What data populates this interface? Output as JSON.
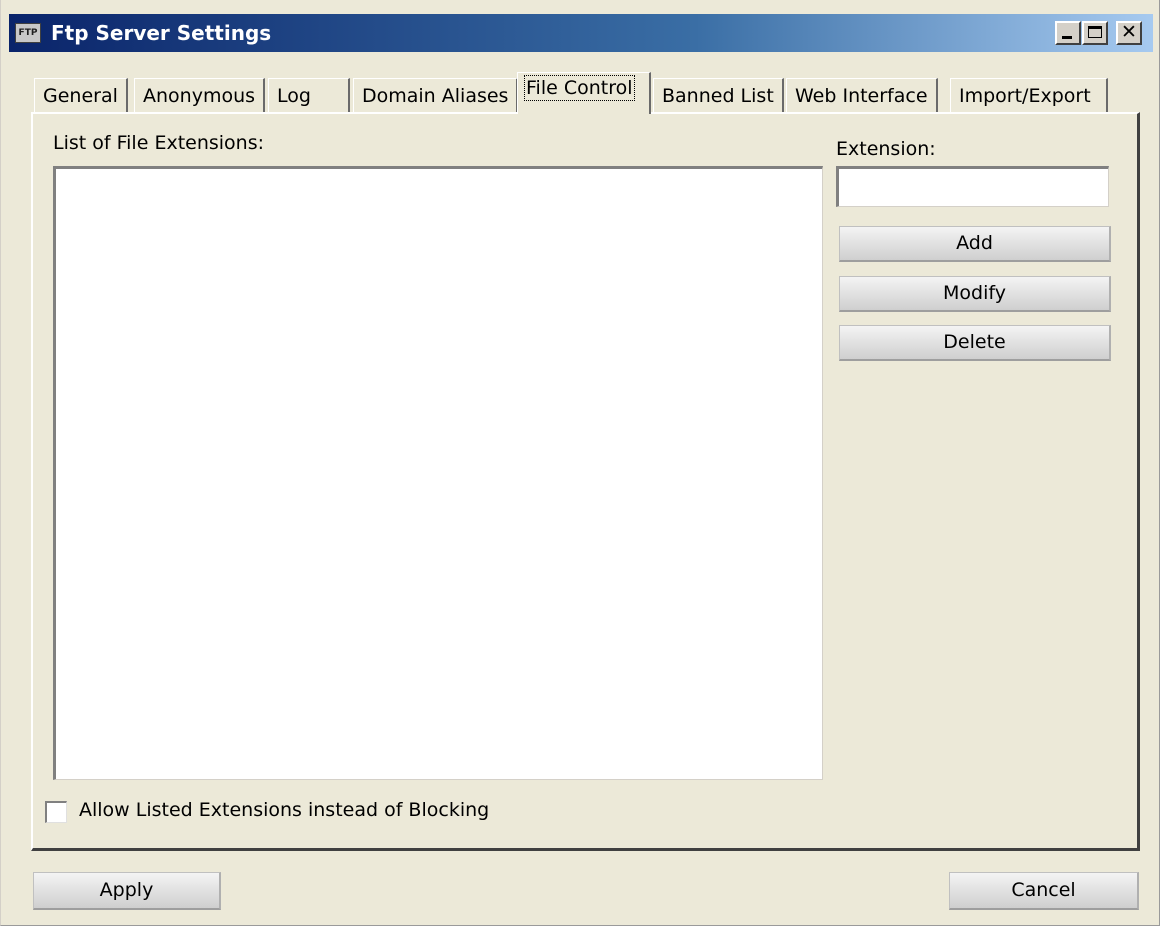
{
  "window": {
    "title": "Ftp Server Settings",
    "icon_text": "FTP",
    "controls": {
      "minimize": "minimize-icon",
      "maximize": "maximize-icon",
      "close_glyph": "✕"
    },
    "colors": {
      "titlebar_start": "#0a246a",
      "titlebar_end": "#a6caf0",
      "face": "#ece9d8"
    }
  },
  "tabs": [
    {
      "label": "General"
    },
    {
      "label": "Anonymous"
    },
    {
      "label": "Log"
    },
    {
      "label": "Domain Aliases"
    },
    {
      "label": "File Control"
    },
    {
      "label": "Banned List"
    },
    {
      "label": "Web Interface"
    },
    {
      "label": "Import/Export"
    }
  ],
  "active_tab": "File Control",
  "file_control": {
    "list_label": "List of File Extensions:",
    "list_items": [],
    "extension_label": "Extension:",
    "extension_value": "",
    "buttons": {
      "add": "Add",
      "modify": "Modify",
      "delete": "Delete"
    },
    "allow_listed": {
      "label": "Allow Listed Extensions instead of Blocking",
      "checked": false
    }
  },
  "footer": {
    "apply": "Apply",
    "cancel": "Cancel"
  }
}
